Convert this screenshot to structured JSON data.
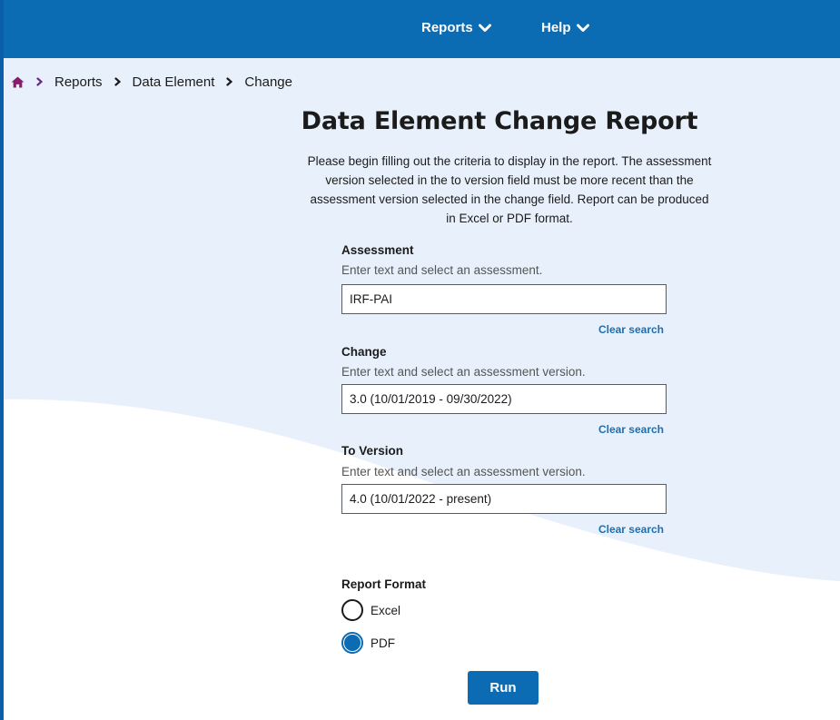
{
  "nav": {
    "reports_label": "Reports",
    "help_label": "Help"
  },
  "breadcrumb": {
    "items": [
      "Reports",
      "Data Element",
      "Change"
    ]
  },
  "page": {
    "title": "Data Element Change Report",
    "intro": "Please begin filling out the criteria to display in the report. The assessment version selected in the to version field must be more recent than the assessment version selected in the change field. Report can be produced in Excel or PDF format."
  },
  "form": {
    "assessment": {
      "label": "Assessment",
      "hint": "Enter text and select an assessment.",
      "value": "IRF-PAI",
      "clear_label": "Clear search"
    },
    "change": {
      "label": "Change",
      "hint": "Enter text and select an assessment version.",
      "value": "3.0 (10/01/2019 - 09/30/2022)",
      "clear_label": "Clear search"
    },
    "to_version": {
      "label": "To Version",
      "hint": "Enter text and select an assessment version.",
      "value": "4.0 (10/01/2022 - present)",
      "clear_label": "Clear search"
    },
    "report_format": {
      "label": "Report Format",
      "options": [
        {
          "label": "Excel",
          "selected": false
        },
        {
          "label": "PDF",
          "selected": true
        }
      ]
    },
    "run_label": "Run"
  },
  "colors": {
    "header": "#0b6bb3",
    "accent": "#0b6bb3",
    "background_tint": "#e8f1fb",
    "home_icon": "#8b1a6f",
    "link": "#1a6fb5"
  },
  "icons": {
    "home": "home-icon",
    "breadcrumb_separator": "chevron-right-icon",
    "nav_dropdown": "chevron-down-icon"
  }
}
